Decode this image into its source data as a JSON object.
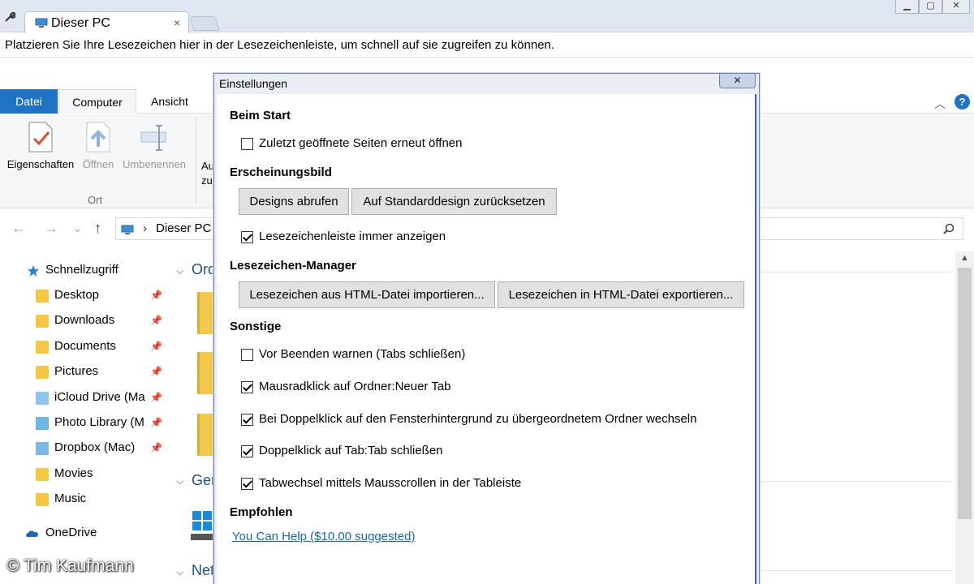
{
  "window": {
    "tab_title": "Dieser PC",
    "tab_close": "×",
    "controls": [
      "▁",
      "▢",
      "✕"
    ]
  },
  "bookmark_bar": {
    "hint": "Platzieren Sie Ihre Lesezeichen hier in der Lesezeichenleiste, um schnell auf sie zugreifen zu können."
  },
  "ribbon": {
    "tabs": [
      "Datei",
      "Computer",
      "Ansicht"
    ],
    "buttons": [
      {
        "label": "Eigenschaften",
        "icon": "properties-icon",
        "enabled": true
      },
      {
        "label": "Öffnen",
        "icon": "open-icon",
        "enabled": false
      },
      {
        "label": "Umbenennen",
        "icon": "rename-icon",
        "enabled": false
      }
    ],
    "group_label": "Ort",
    "partial_lines": [
      "Au",
      "zu"
    ],
    "help": "?",
    "collapse": "︿"
  },
  "address": {
    "back": "←",
    "forward": "→",
    "history": "⌄",
    "up": "↑",
    "separator": "›",
    "crumb": "Dieser PC"
  },
  "nav_pane": {
    "items": [
      {
        "label": "Schnellzugriff",
        "icon": "star-icon",
        "pinned": false
      },
      {
        "label": "Desktop",
        "icon": "folder-icon",
        "pinned": true
      },
      {
        "label": "Downloads",
        "icon": "folder-icon",
        "pinned": true
      },
      {
        "label": "Documents",
        "icon": "folder-icon",
        "pinned": true
      },
      {
        "label": "Pictures",
        "icon": "folder-icon",
        "pinned": true
      },
      {
        "label": "iCloud Drive (Ma",
        "icon": "cloud-folder-icon",
        "pinned": true
      },
      {
        "label": "Photo Library (M",
        "icon": "photo-folder-icon",
        "pinned": true
      },
      {
        "label": "Dropbox (Mac)",
        "icon": "dropbox-folder-icon",
        "pinned": true
      },
      {
        "label": "Movies",
        "icon": "folder-icon",
        "pinned": false
      },
      {
        "label": "Music",
        "icon": "folder-icon",
        "pinned": false
      },
      {
        "label": "OneDrive",
        "icon": "onedrive-icon",
        "pinned": false
      }
    ],
    "pin_glyph": "📌"
  },
  "content": {
    "sections": [
      "Ord",
      "Ger",
      "Net"
    ]
  },
  "dialog": {
    "title": "Einstellungen",
    "close": "✕",
    "sections": {
      "start": {
        "heading": "Beim Start",
        "options": [
          {
            "label": "Zuletzt geöffnete Seiten erneut öffnen",
            "checked": false
          }
        ]
      },
      "appearance": {
        "heading": "Erscheinungsbild",
        "buttons": [
          "Designs abrufen",
          "Auf Standarddesign zurücksetzen"
        ],
        "options": [
          {
            "label": "Lesezeichenleiste immer anzeigen",
            "checked": true
          }
        ]
      },
      "bookmarks": {
        "heading": "Lesezeichen-Manager",
        "buttons": [
          "Lesezeichen aus HTML-Datei importieren...",
          "Lesezeichen in HTML-Datei exportieren..."
        ]
      },
      "other": {
        "heading": "Sonstige",
        "options": [
          {
            "label": "Vor Beenden warnen (Tabs schließen)",
            "checked": false
          },
          {
            "label": "Mausradklick auf Ordner:Neuer Tab",
            "checked": true
          },
          {
            "label": "Bei Doppelklick auf den Fensterhintergrund zu übergeordnetem Ordner wechseln",
            "checked": true
          },
          {
            "label": "Doppelklick auf Tab:Tab schließen",
            "checked": true
          },
          {
            "label": "Tabwechsel mittels Mausscrollen in der Tableiste",
            "checked": true
          }
        ]
      },
      "recommended": {
        "heading": "Empfohlen",
        "link": "You Can Help ($10.00 suggested)"
      }
    }
  },
  "watermark": "© Tim Kaufmann"
}
